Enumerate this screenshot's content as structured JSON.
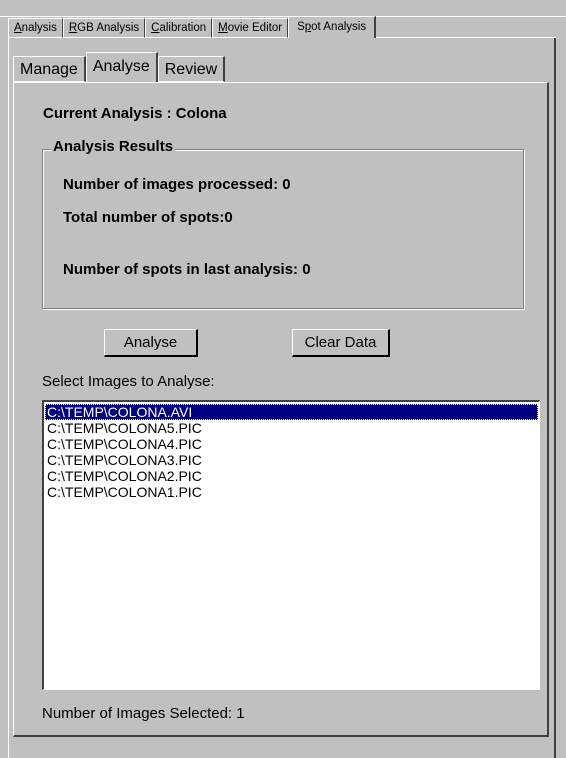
{
  "outer_tabs": [
    {
      "pre": "",
      "u": "A",
      "post": "nalysis"
    },
    {
      "pre": "",
      "u": "R",
      "post": "GB Analysis"
    },
    {
      "pre": "",
      "u": "C",
      "post": "alibration"
    },
    {
      "pre": "",
      "u": "M",
      "post": "ovie Editor"
    },
    {
      "pre": "S",
      "u": "p",
      "post": "ot Analysis"
    }
  ],
  "inner_tabs": [
    "Manage",
    "Analyse",
    "Review"
  ],
  "current_analysis": "Current Analysis :  Colona",
  "results": {
    "group_label": "Analysis Results",
    "images_processed": "Number of images processed:  0",
    "total_spots": "Total number of spots:0",
    "spots_last": "Number of spots in last analysis:  0"
  },
  "buttons": {
    "analyse": "Analyse",
    "clear": "Clear Data"
  },
  "select_label": "Select Images to Analyse:",
  "images": [
    "C:\\TEMP\\COLONA.AVI",
    "C:\\TEMP\\COLONA5.PIC",
    "C:\\TEMP\\COLONA4.PIC",
    "C:\\TEMP\\COLONA3.PIC",
    "C:\\TEMP\\COLONA2.PIC",
    "C:\\TEMP\\COLONA1.PIC"
  ],
  "selected_count": "Number of Images Selected:   1"
}
